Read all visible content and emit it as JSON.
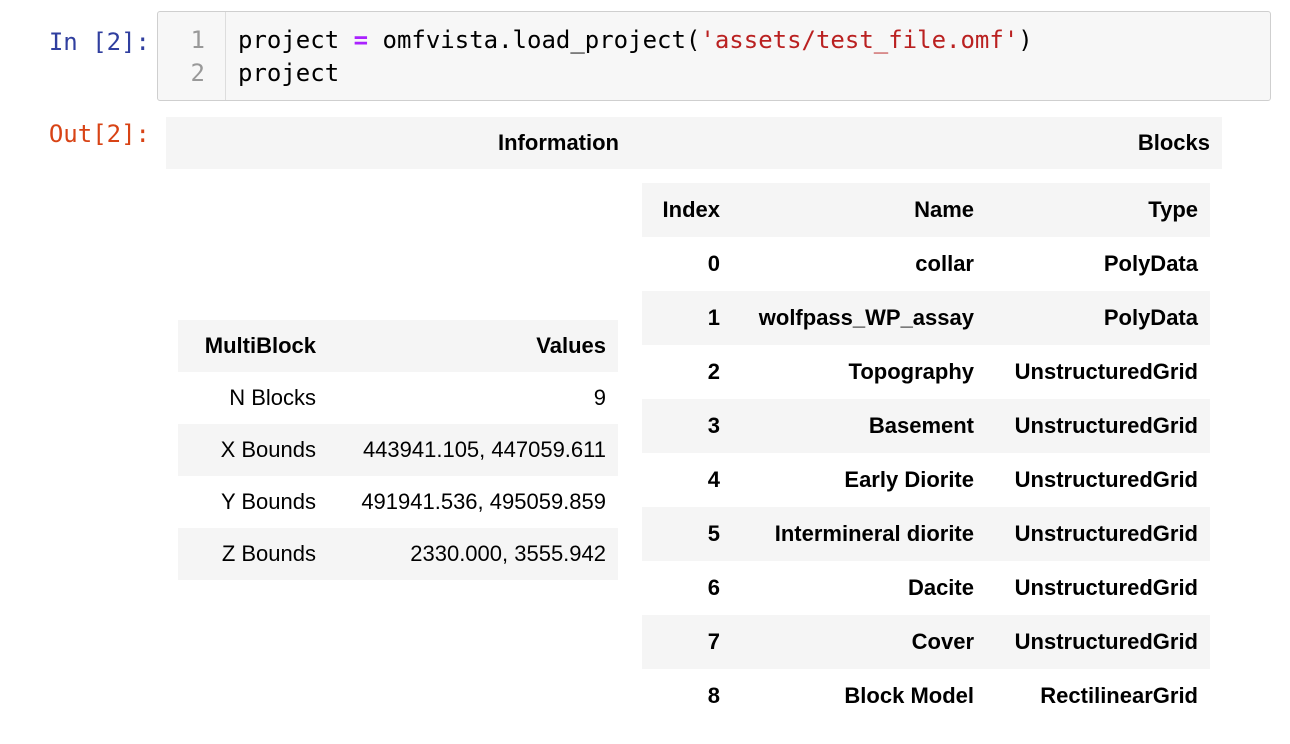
{
  "input_prompt": "In [2]:",
  "output_prompt": "Out[2]:",
  "code_cell": {
    "lines": [
      {
        "number": "1",
        "tokens": [
          {
            "text": "project ",
            "kind": "name"
          },
          {
            "text": "=",
            "kind": "op"
          },
          {
            "text": " omfvista.load_project(",
            "kind": "name"
          },
          {
            "text": "'assets/test_file.omf'",
            "kind": "str"
          },
          {
            "text": ")",
            "kind": "name"
          }
        ]
      },
      {
        "number": "2",
        "tokens": [
          {
            "text": "project",
            "kind": "name"
          }
        ]
      }
    ]
  },
  "output": {
    "header": {
      "information": "Information",
      "blocks": "Blocks"
    },
    "info_table": {
      "columns": [
        "MultiBlock",
        "Values"
      ],
      "rows": [
        [
          "N Blocks",
          "9"
        ],
        [
          "X Bounds",
          "443941.105, 447059.611"
        ],
        [
          "Y Bounds",
          "491941.536, 495059.859"
        ],
        [
          "Z Bounds",
          "2330.000, 3555.942"
        ]
      ]
    },
    "blocks_table": {
      "columns": [
        "Index",
        "Name",
        "Type"
      ],
      "rows": [
        [
          "0",
          "collar",
          "PolyData"
        ],
        [
          "1",
          "wolfpass_WP_assay",
          "PolyData"
        ],
        [
          "2",
          "Topography",
          "UnstructuredGrid"
        ],
        [
          "3",
          "Basement",
          "UnstructuredGrid"
        ],
        [
          "4",
          "Early Diorite",
          "UnstructuredGrid"
        ],
        [
          "5",
          "Intermineral diorite",
          "UnstructuredGrid"
        ],
        [
          "6",
          "Dacite",
          "UnstructuredGrid"
        ],
        [
          "7",
          "Cover",
          "UnstructuredGrid"
        ],
        [
          "8",
          "Block Model",
          "RectilinearGrid"
        ]
      ]
    }
  },
  "colors": {
    "input_prompt": "#303f9f",
    "output_prompt": "#d84315",
    "operator": "#aa22ff",
    "string": "#ba2121",
    "row_shade": "#f5f5f5"
  }
}
